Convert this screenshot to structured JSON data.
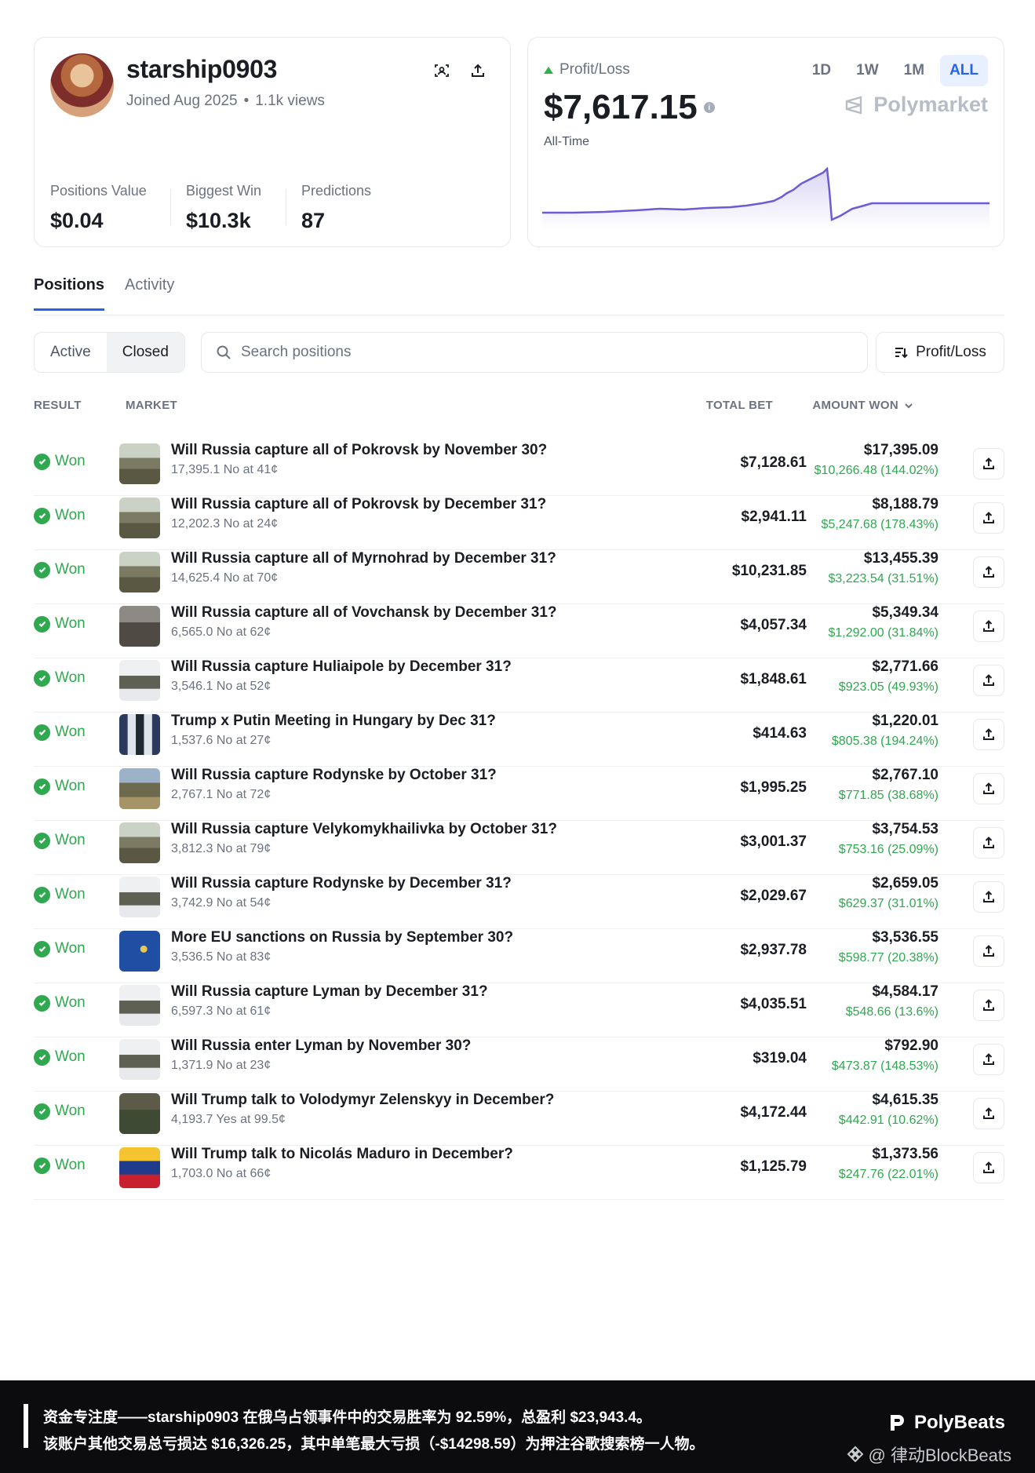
{
  "profile": {
    "username": "starship0903",
    "joined": "Joined Aug 2025",
    "views": "1.1k views",
    "stats": [
      {
        "label": "Positions Value",
        "value": "$0.04"
      },
      {
        "label": "Biggest Win",
        "value": "$10.3k"
      },
      {
        "label": "Predictions",
        "value": "87"
      }
    ]
  },
  "pnl": {
    "label": "Profit/Loss",
    "value": "$7,617.15",
    "period": "All-Time",
    "brand": "Polymarket",
    "ranges": [
      "1D",
      "1W",
      "1M",
      "ALL"
    ],
    "active_range": "ALL",
    "line_color": "#6b5bd6",
    "up_color": "#2fb04d"
  },
  "tabs": {
    "positions": "Positions",
    "activity": "Activity"
  },
  "filters": {
    "active": "Active",
    "closed": "Closed",
    "search_placeholder": "Search positions",
    "sort": "Profit/Loss"
  },
  "table": {
    "headers": {
      "result": "RESULT",
      "market": "MARKET",
      "total_bet": "TOTAL BET",
      "amount_won": "AMOUNT WON"
    },
    "rows": [
      {
        "result": "Won",
        "title": "Will Russia capture all of Pokrovsk by November 30?",
        "sub": "17,395.1 No at 41¢",
        "bet": "$7,128.61",
        "won": "$17,395.09",
        "gain": "$10,266.48 (144.02%)",
        "thumb": "tank"
      },
      {
        "result": "Won",
        "title": "Will Russia capture all of Pokrovsk by December 31?",
        "sub": "12,202.3 No at 24¢",
        "bet": "$2,941.11",
        "won": "$8,188.79",
        "gain": "$5,247.68 (178.43%)",
        "thumb": "tank"
      },
      {
        "result": "Won",
        "title": "Will Russia capture all of Myrnohrad by December 31?",
        "sub": "14,625.4 No at 70¢",
        "bet": "$10,231.85",
        "won": "$13,455.39",
        "gain": "$3,223.54 (31.51%)",
        "thumb": "tank"
      },
      {
        "result": "Won",
        "title": "Will Russia capture all of Vovchansk by December 31?",
        "sub": "6,565.0 No at 62¢",
        "bet": "$4,057.34",
        "won": "$5,349.34",
        "gain": "$1,292.00 (31.84%)",
        "thumb": "ruins"
      },
      {
        "result": "Won",
        "title": "Will Russia capture Huliaipole by December 31?",
        "sub": "3,546.1 No at 52¢",
        "bet": "$1,848.61",
        "won": "$2,771.66",
        "gain": "$923.05 (49.93%)",
        "thumb": "tank-snow"
      },
      {
        "result": "Won",
        "title": "Trump x Putin Meeting in Hungary by Dec 31?",
        "sub": "1,537.6 No at 27¢",
        "bet": "$414.63",
        "won": "$1,220.01",
        "gain": "$805.38 (194.24%)",
        "thumb": "people"
      },
      {
        "result": "Won",
        "title": "Will Russia capture Rodynske by October 31?",
        "sub": "2,767.1 No at 72¢",
        "bet": "$1,995.25",
        "won": "$2,767.10",
        "gain": "$771.85 (38.68%)",
        "thumb": "tank-field"
      },
      {
        "result": "Won",
        "title": "Will Russia capture Velykomykhailivka by October 31?",
        "sub": "3,812.3 No at 79¢",
        "bet": "$3,001.37",
        "won": "$3,754.53",
        "gain": "$753.16 (25.09%)",
        "thumb": "tank"
      },
      {
        "result": "Won",
        "title": "Will Russia capture Rodynske by December 31?",
        "sub": "3,742.9 No at 54¢",
        "bet": "$2,029.67",
        "won": "$2,659.05",
        "gain": "$629.37 (31.01%)",
        "thumb": "tank-snow"
      },
      {
        "result": "Won",
        "title": "More EU sanctions on Russia by September 30?",
        "sub": "3,536.5 No at 83¢",
        "bet": "$2,937.78",
        "won": "$3,536.55",
        "gain": "$598.77 (20.38%)",
        "thumb": "eu"
      },
      {
        "result": "Won",
        "title": "Will Russia capture Lyman by December 31?",
        "sub": "6,597.3 No at 61¢",
        "bet": "$4,035.51",
        "won": "$4,584.17",
        "gain": "$548.66 (13.6%)",
        "thumb": "tank-snow"
      },
      {
        "result": "Won",
        "title": "Will Russia enter Lyman by November 30?",
        "sub": "1,371.9 No at 23¢",
        "bet": "$319.04",
        "won": "$792.90",
        "gain": "$473.87 (148.53%)",
        "thumb": "tank-snow"
      },
      {
        "result": "Won",
        "title": "Will Trump talk to Volodymyr Zelenskyy in December?",
        "sub": "4,193.7 Yes at 99.5¢",
        "bet": "$4,172.44",
        "won": "$4,615.35",
        "gain": "$442.91 (10.62%)",
        "thumb": "portrait-green"
      },
      {
        "result": "Won",
        "title": "Will Trump talk to Nicolás Maduro in December?",
        "sub": "1,703.0 No at 66¢",
        "bet": "$1,125.79",
        "won": "$1,373.56",
        "gain": "$247.76 (22.01%)",
        "thumb": "portrait-flag"
      }
    ]
  },
  "banner": {
    "line1": "资金专注度——starship0903 在俄乌占领事件中的交易胜率为 92.59%，总盈利 $23,943.4。",
    "line2": "该账户其他交易总亏损达 $16,326.25，其中单笔最大亏损（-$14298.59）为押注谷歌搜索榜一人物。",
    "brand": "PolyBeats",
    "credit": "@ 律动BlockBeats"
  }
}
